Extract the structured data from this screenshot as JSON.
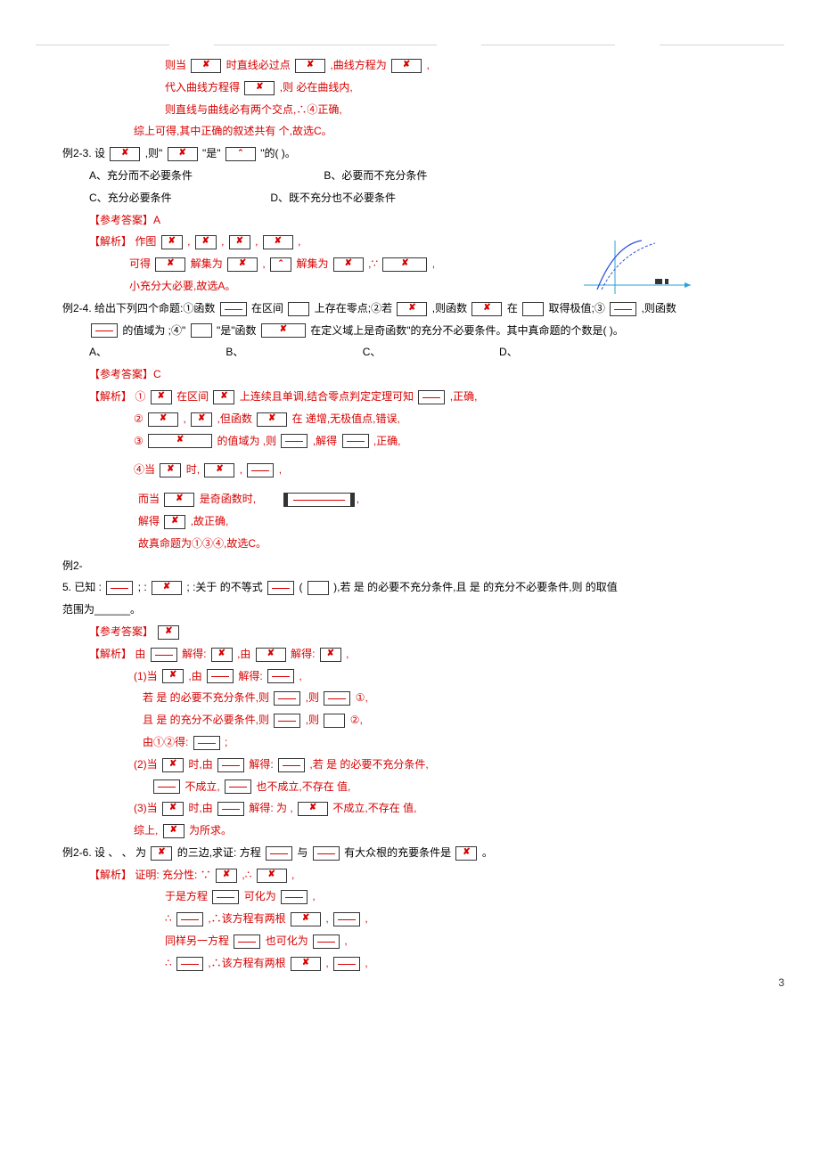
{
  "solution_23": {
    "l1a": "则当",
    "l1b": "时直线必过点",
    "l1c": ",曲线方程为",
    "l1d": ",",
    "l2a": "代入曲线方程得",
    "l2b": ",则",
    "l2c": "必在曲线内,",
    "l3": "则直线与曲线必有两个交点,∴④正确,",
    "l4": "综上可得,其中正确的叙述共有 个,故选C。"
  },
  "ex23": {
    "stem_a": "例2-3.  设",
    "stem_b": ",则\"",
    "stem_c": "\"是\"",
    "stem_d": "\"的(  )。",
    "opts": {
      "A": "A、充分而不必要条件",
      "B": "B、必要而不充分条件",
      "C": "C、充分必要条件",
      "D": "D、既不充分也不必要条件"
    },
    "ans_label": "【参考答案】",
    "ans": "A",
    "sol_label": "【解析】",
    "s1a": "作图",
    "s1b": ",",
    "s1c": ",",
    "s1d": ",",
    "s1e": ",",
    "s2a": "可得",
    "s2b": "解集为",
    "s2c": ",",
    "s2d": "解集为",
    "s2e": ",∵",
    "s2f": ",",
    "s3": "小充分大必要,故选A。"
  },
  "ex24": {
    "stem_a": "例2-4. 给出下列四个命题:①函数",
    "stem_b": "在区间",
    "stem_c": "上存在零点;②若",
    "stem_d": ",则函数",
    "stem_e": "在",
    "stem_f": "取得极值;③",
    "stem_g": ",则函数",
    "line2a": "的值域为 ;④\"",
    "line2b": "\"是\"函数",
    "line2c": "在定义域上是奇函数\"的充分不必要条件。其中真命题的个数是(  )。",
    "opts": {
      "A": "A、",
      "B": "B、",
      "C": "C、",
      "D": "D、"
    },
    "ans_label": "【参考答案】",
    "ans": "C",
    "sol_label": "【解析】",
    "s1a": "①",
    "s1b": "在区间",
    "s1c": "上连续且单调,结合零点判定定理可知",
    "s1d": ",正确,",
    "s2a": "②",
    "s2b": ",",
    "s2c": ",但函数",
    "s2d": "在 递增,无极值点,错误,",
    "s3a": "③",
    "s3b": "的值域为 ,则",
    "s3c": ",解得",
    "s3d": ",正确,",
    "s4a": "④当",
    "s4b": "时,",
    "s4c": ",",
    "s4d": ",",
    "s5a": "而当",
    "s5b": "是奇函数时,",
    "s5c": ",",
    "s6a": "解得",
    "s6b": ",故正确,",
    "s7": "故真命题为①③④,故选C。"
  },
  "ex25": {
    "head": "例2-",
    "stem_a": "5.  已知 :",
    "stem_b": "; :",
    "stem_c": "; :关于 的不等式",
    "stem_d": "(",
    "stem_e": "),若 是 的必要不充分条件,且 是 的充分不必要条件,则 的取值",
    "line2": "范围为______。",
    "ans_label": "【参考答案】",
    "sol_label": "【解析】",
    "s1a": "由",
    "s1b": "解得:",
    "s1c": ",由",
    "s1d": "解得:",
    "s1e": ",",
    "s2a": "(1)当",
    "s2b": ",由",
    "s2c": "解得:",
    "s2d": ",",
    "s3a": "若 是 的必要不充分条件,则",
    "s3b": ",则",
    "s3c": "①,",
    "s4a": "且 是 的充分不必要条件,则",
    "s4b": ",则",
    "s4c": "②,",
    "s5a": "由①②得:",
    "s5b": ";",
    "s6a": "(2)当",
    "s6b": "时,由",
    "s6c": "解得:",
    "s6d": ",若 是 的必要不充分条件,",
    "s7a": "不成立,",
    "s7b": "也不成立,不存在 值,",
    "s8a": "(3)当",
    "s8b": "时,由",
    "s8c": "解得: 为 ,",
    "s8d": "不成立,不存在 值,",
    "s9a": "综上,",
    "s9b": "为所求。"
  },
  "ex26": {
    "stem_a": "例2-6. 设 、 、 为",
    "stem_b": "的三边,求证: 方程",
    "stem_c": "与",
    "stem_d": "有大众根的充要条件是",
    "stem_e": "。",
    "sol_label": "【解析】",
    "s1a": "证明: 充分性: ∵",
    "s1b": ",∴",
    "s1c": ",",
    "s2a": "于是方程",
    "s2b": "可化为",
    "s2c": ",",
    "s3a": "∴",
    "s3b": ",∴该方程有两根",
    "s3c": ",",
    "s3d": ",",
    "s4a": "同样另一方程",
    "s4b": "也可化为",
    "s4c": ",",
    "s5a": "∴",
    "s5b": ",∴该方程有两根",
    "s5c": ",",
    "s5d": ","
  },
  "page_num": "3",
  "chart_data": {
    "type": "line",
    "description": "Small schematic sketch of curves for set comparison: coordinate axes with two upward-opening curves (blue solid and blue dashed) through origin region; x-axis extends right with arrow.",
    "axes": {
      "x_arrow": true,
      "y_arrow": true
    },
    "curves": 2
  }
}
